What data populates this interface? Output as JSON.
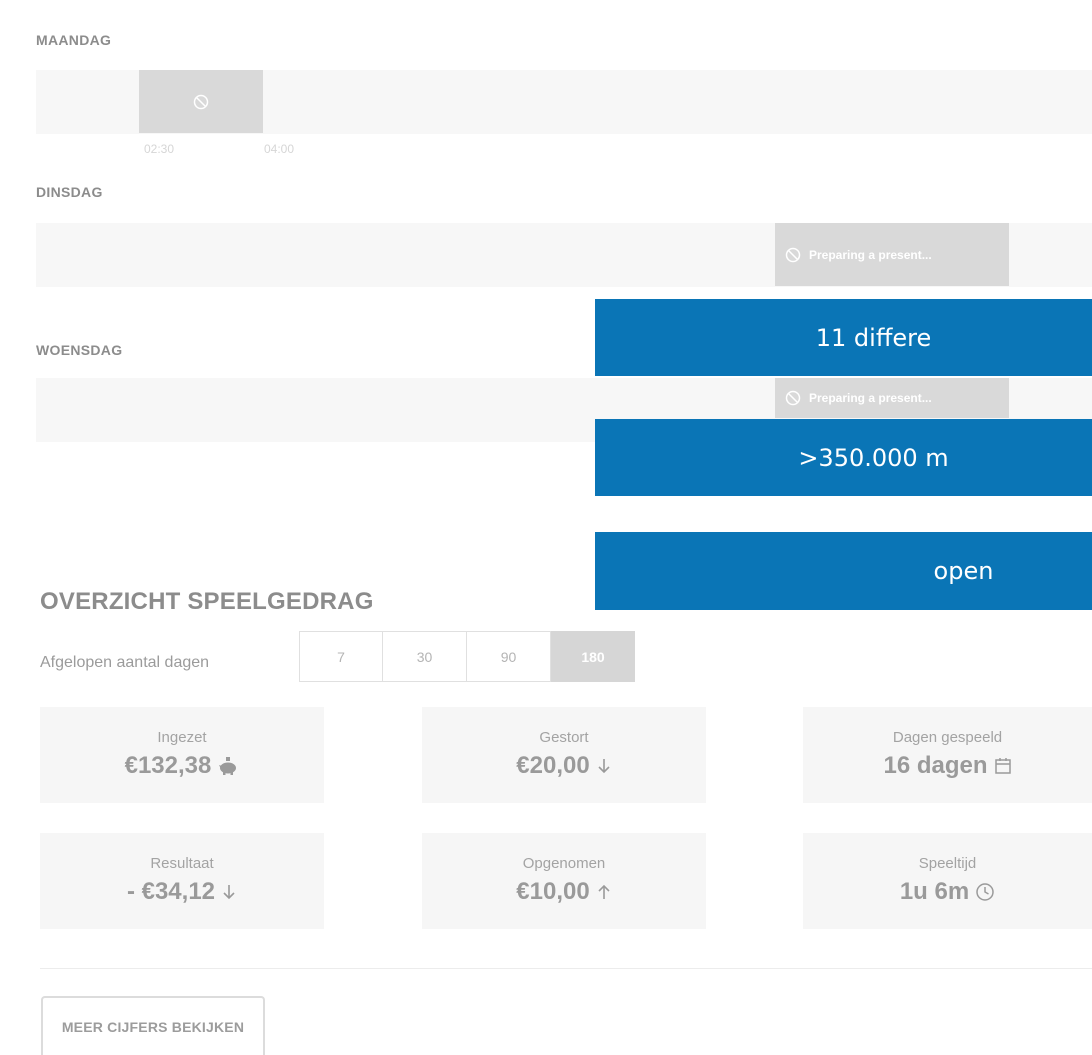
{
  "days": [
    {
      "label": "MAANDAG",
      "blocks": [
        {
          "text": "",
          "ticks": [
            "02:30",
            "04:00"
          ]
        }
      ]
    },
    {
      "label": "DINSDAG",
      "blocks": [
        {
          "text": "Preparing a present...",
          "ticks": [
            "",
            ""
          ]
        }
      ]
    },
    {
      "label": "WOENSDAG",
      "blocks": [
        {
          "text": "Preparing a present..."
        }
      ]
    }
  ],
  "banners": [
    "11 differe",
    ">350.000 m",
    "open"
  ],
  "overview": {
    "title": "OVERZICHT SPEELGEDRAG",
    "period_label": "Afgelopen aantal dagen",
    "periods": [
      "7",
      "30",
      "90",
      "180"
    ],
    "active_period": "180",
    "stats": [
      {
        "label": "Ingezet",
        "value": "€132,38",
        "icon": "piggy-bank-icon"
      },
      {
        "label": "Gestort",
        "value": "€20,00",
        "icon": "arrow-down-icon"
      },
      {
        "label": "Dagen gespeeld",
        "value": "16 dagen",
        "icon": "calendar-icon"
      },
      {
        "label": "Resultaat",
        "value": "- €34,12",
        "icon": "arrow-down-icon"
      },
      {
        "label": "Opgenomen",
        "value": "€10,00",
        "icon": "arrow-up-icon"
      },
      {
        "label": "Speeltijd",
        "value": "1u 6m",
        "icon": "clock-icon"
      }
    ],
    "more_button": "MEER CIJFERS BEKIJKEN"
  }
}
